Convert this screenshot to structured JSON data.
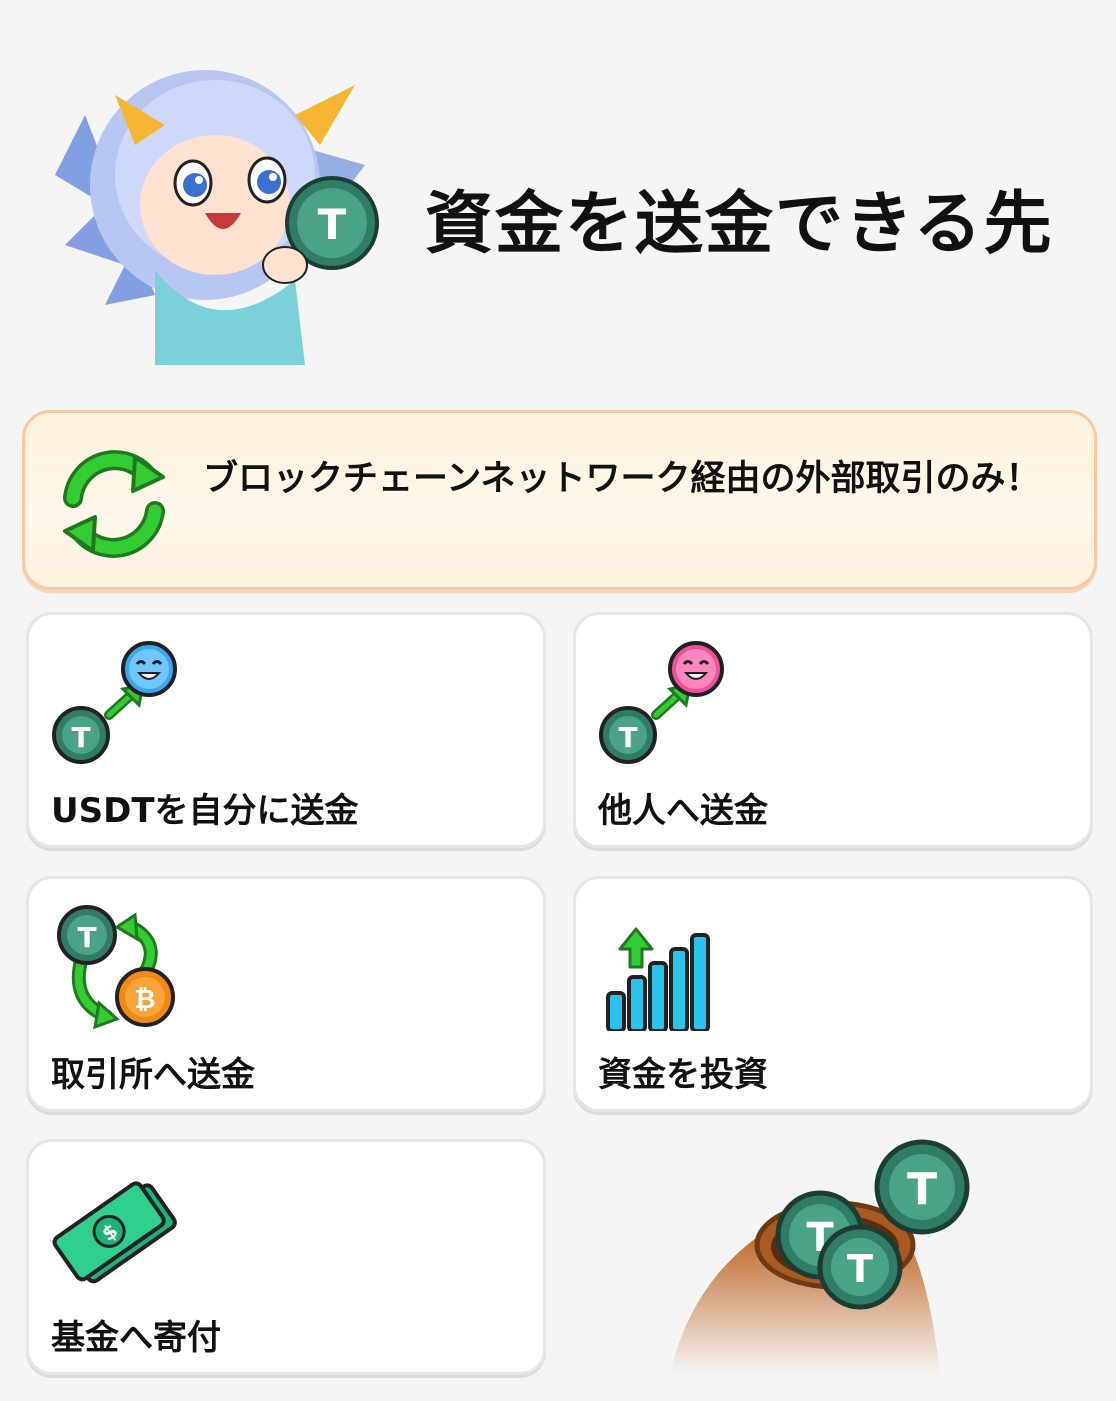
{
  "header": {
    "title": "資金を送金できる先"
  },
  "notice": {
    "text": "ブロックチェーンネットワーク経由の外部取引のみ！"
  },
  "options": [
    {
      "label": "USDTを自分に送金"
    },
    {
      "label": "他人へ送金"
    },
    {
      "label": "取引所へ送金"
    },
    {
      "label": "資金を投資"
    },
    {
      "label": "基金へ寄付"
    }
  ],
  "colors": {
    "background": "#f5f5f5",
    "tether_green": "#3f8f78",
    "arrow_green": "#2ec52e",
    "bitcoin_orange": "#f7931a",
    "banner_border": "#f9c9a0"
  },
  "icons": {
    "banner": "refresh-cycle-icon",
    "self_transfer": "coin-to-blue-face-icon",
    "others_transfer": "coin-to-pink-face-icon",
    "exchange": "usdt-btc-swap-icon",
    "invest": "growth-bars-icon",
    "donate": "cash-bills-icon"
  }
}
